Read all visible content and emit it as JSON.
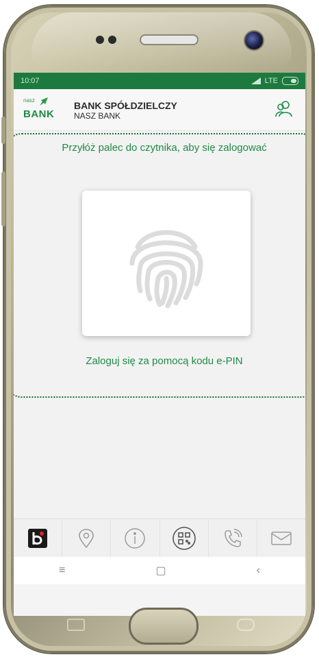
{
  "status_bar": {
    "time": "10:07",
    "network": "LTE"
  },
  "header": {
    "logo_small": "nasz",
    "logo_big": "BANK",
    "bank_name": "BANK SPÓŁDZIELCZY",
    "bank_sub": "NASZ BANK",
    "profile_icon": "users-icon"
  },
  "login": {
    "prompt": "Przyłóż palec do czytnika, aby się zalogować",
    "fingerprint_icon": "fingerprint-icon",
    "epin_link": "Zaloguj się za pomocą kodu e-PIN"
  },
  "bottom_nav": {
    "items": [
      {
        "icon": "bank-logo-icon"
      },
      {
        "icon": "location-pin-icon"
      },
      {
        "icon": "info-icon"
      },
      {
        "icon": "qr-code-icon"
      },
      {
        "icon": "phone-icon"
      },
      {
        "icon": "mail-icon"
      }
    ]
  },
  "system_nav": {
    "recent": "≡",
    "home": "▢",
    "back": "‹"
  },
  "colors": {
    "brand_green": "#1f8a45",
    "status_bar": "#1d7a3f"
  }
}
